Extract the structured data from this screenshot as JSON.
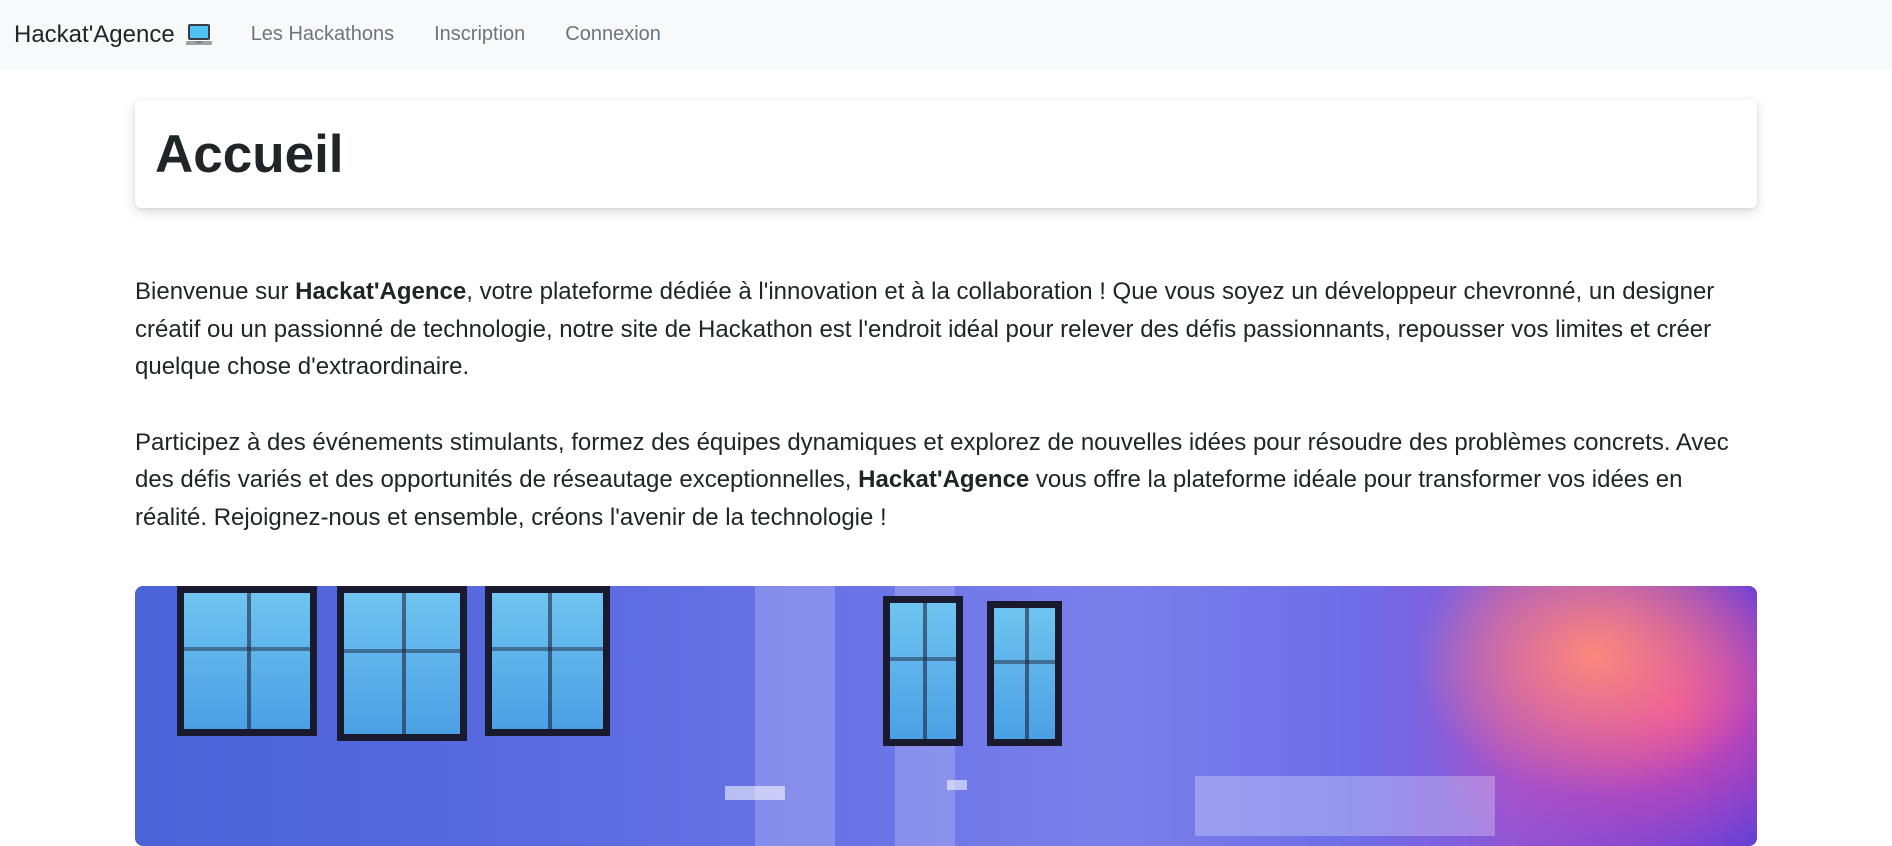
{
  "navbar": {
    "brand": "Hackat'Agence",
    "brand_icon": "laptop-icon",
    "links": [
      "Les Hackathons",
      "Inscription",
      "Connexion"
    ]
  },
  "header": {
    "title": "Accueil"
  },
  "intro": {
    "p1": {
      "before": "Bienvenue sur ",
      "strong": "Hackat'Agence",
      "after": ", votre plateforme dédiée à l'innovation et à la collaboration ! Que vous soyez un développeur chevronné, un designer créatif ou un passionné de technologie, notre site de Hackathon est l'endroit idéal pour relever des défis passionnants, repousser vos limites et créer quelque chose d'extraordinaire."
    },
    "p2": {
      "before": "Participez à des événements stimulants, formez des équipes dynamiques et explorez de nouvelles idées pour résoudre des problèmes concrets. Avec des défis variés et des opportunités de réseautage exceptionnelles, ",
      "strong": "Hackat'Agence",
      "after": " vous offre la plateforme idéale pour transformer vos idées en réalité. Rejoignez-nous et ensemble, créons l'avenir de la technologie !"
    }
  },
  "colors": {
    "navbar_bg": "#f8f9fa",
    "text": "#212529",
    "nav_link": "#6c757d"
  }
}
